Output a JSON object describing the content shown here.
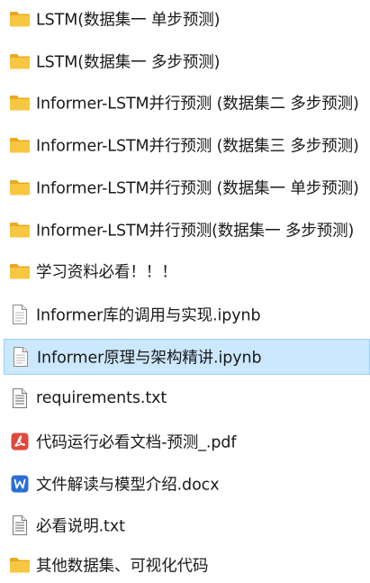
{
  "items": [
    {
      "name": "LSTM(数据集一 单步预测)",
      "icon": "folder-icon",
      "selected": false
    },
    {
      "name": "LSTM(数据集一 多步预测)",
      "icon": "folder-icon",
      "selected": false
    },
    {
      "name": "Informer-LSTM并行预测 (数据集二 多步预测)",
      "icon": "folder-icon",
      "selected": false
    },
    {
      "name": "Informer-LSTM并行预测 (数据集三 多步预测)",
      "icon": "folder-icon",
      "selected": false
    },
    {
      "name": "Informer-LSTM并行预测 (数据集一 单步预测)",
      "icon": "folder-icon",
      "selected": false
    },
    {
      "name": "Informer-LSTM并行预测(数据集一 多步预测)",
      "icon": "folder-icon",
      "selected": false
    },
    {
      "name": "学习资料必看！！！",
      "icon": "folder-icon",
      "selected": false
    },
    {
      "name": "Informer库的调用与实现.ipynb",
      "icon": "document-icon",
      "selected": false
    },
    {
      "name": "Informer原理与架构精讲.ipynb",
      "icon": "document-icon",
      "selected": true
    },
    {
      "name": "requirements.txt",
      "icon": "text-file-icon",
      "selected": false
    },
    {
      "name": "代码运行必看文档-预测_.pdf",
      "icon": "pdf-icon",
      "selected": false
    },
    {
      "name": "文件解读与模型介绍.docx",
      "icon": "word-icon",
      "selected": false
    },
    {
      "name": "必看说明.txt",
      "icon": "text-file-icon",
      "selected": false
    },
    {
      "name": "其他数据集、可视化代码",
      "icon": "folder-icon",
      "selected": false
    }
  ],
  "colors": {
    "folder": "#f8c741",
    "folder_back": "#e8a920",
    "selection_bg": "#cce8ff",
    "selection_border": "#99d1ff",
    "pdf": "#e2463c",
    "word": "#2b6fd6"
  }
}
